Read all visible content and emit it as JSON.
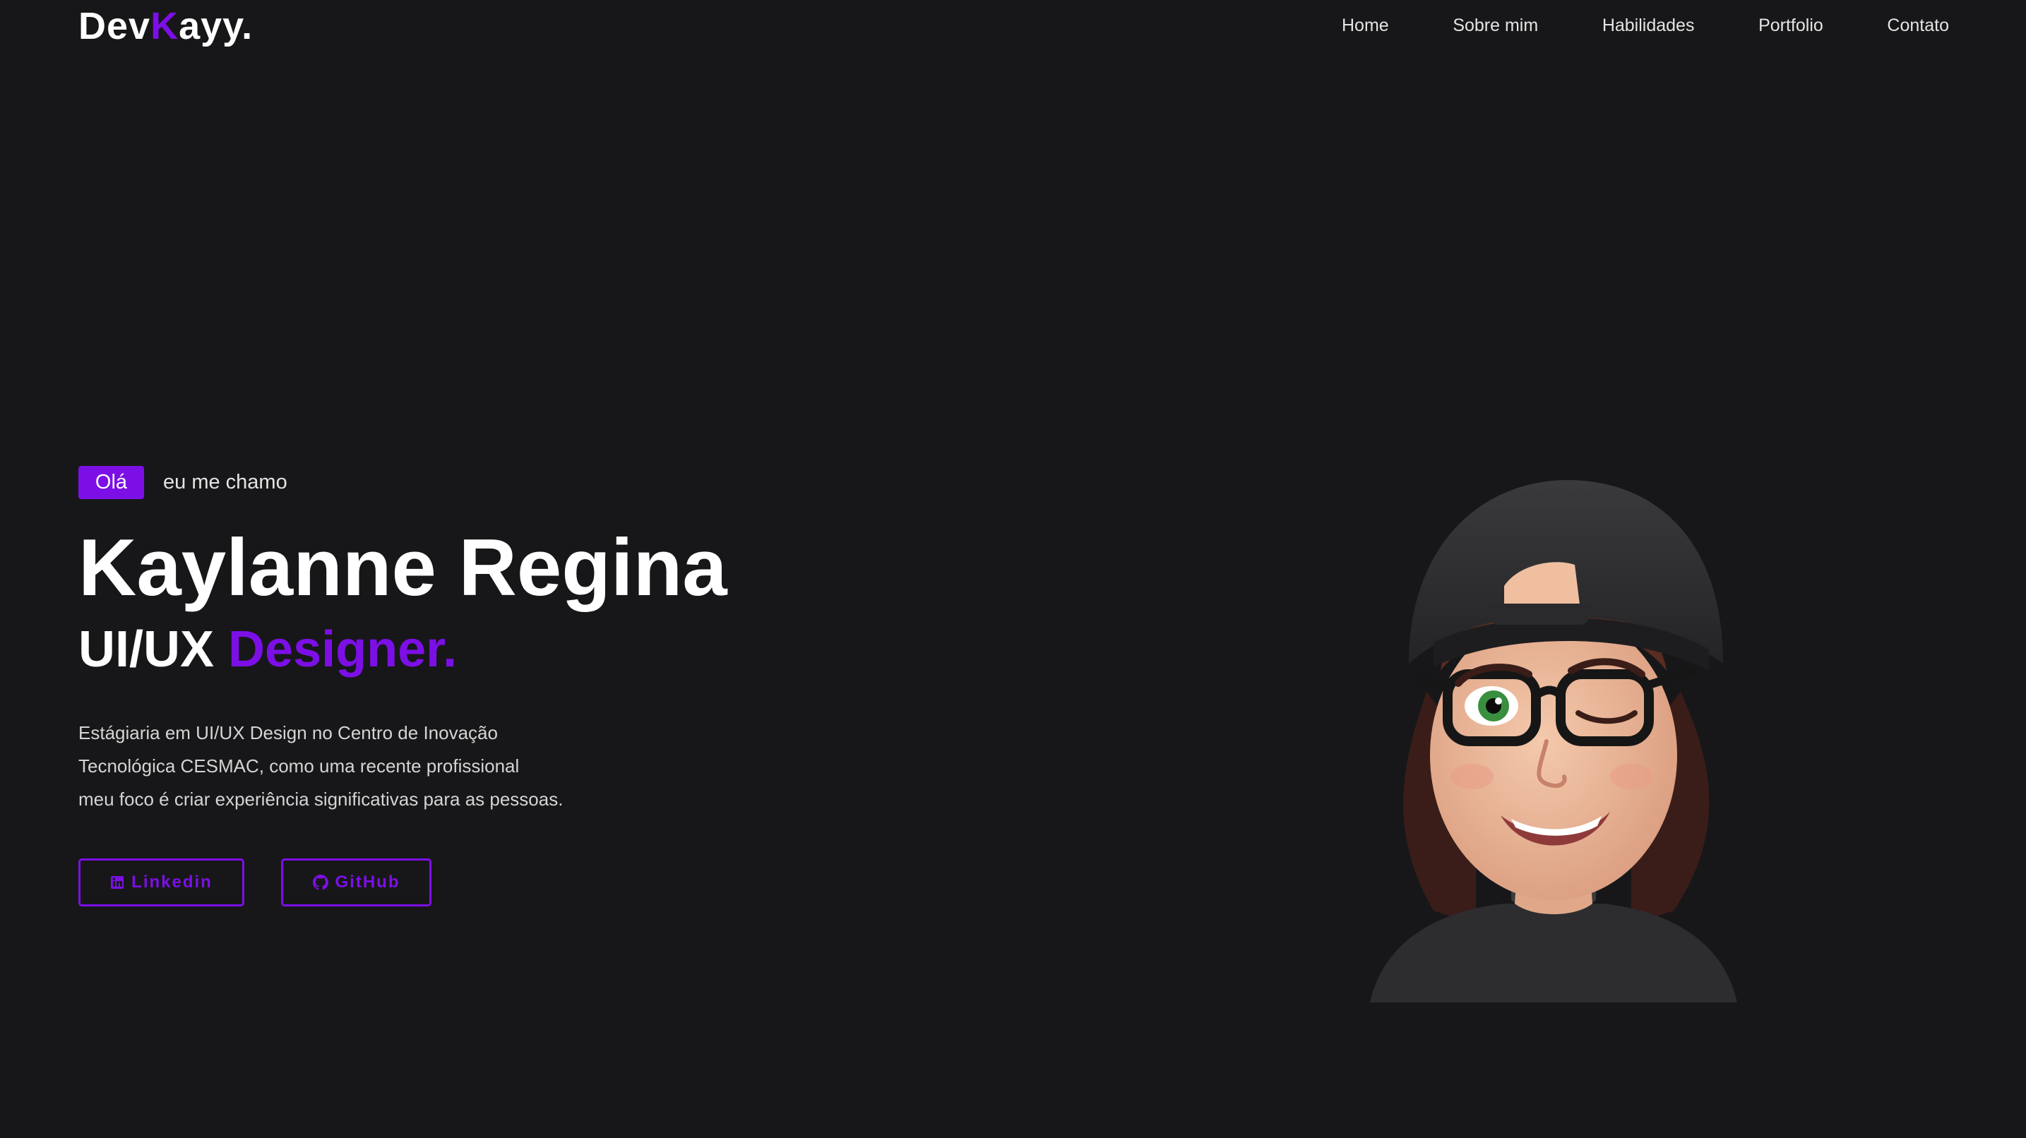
{
  "header": {
    "logo_part1": "Dev",
    "logo_accent": "K",
    "logo_part2": "ayy.",
    "nav": [
      {
        "label": "Home"
      },
      {
        "label": "Sobre mim"
      },
      {
        "label": "Habilidades"
      },
      {
        "label": "Portfolio"
      },
      {
        "label": "Contato"
      }
    ]
  },
  "hero": {
    "badge": "Olá",
    "greeting": "eu me chamo",
    "name": "Kaylanne Regina",
    "role_prefix": "UI/UX",
    "role_accent": "Designer.",
    "bio_lines": [
      "Estágiaria em UI/UX Design no Centro de Inovação",
      "Tecnológica CESMAC, como uma recente profissional",
      "meu foco é criar experiência significativas para as pessoas."
    ],
    "buttons": {
      "linkedin_label": "Linkedin",
      "linkedin_icon": "linkedin-icon",
      "github_label": "GitHub",
      "github_icon": "github-icon"
    }
  },
  "colors": {
    "background": "#171719",
    "accent": "#7c0fe6",
    "text": "#ffffff"
  }
}
